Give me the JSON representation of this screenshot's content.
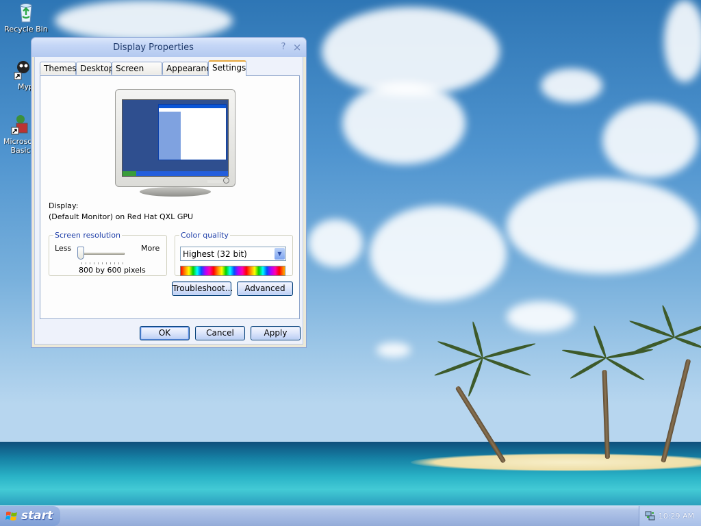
{
  "desktop": {
    "icons": [
      {
        "label": "Recycle Bin"
      },
      {
        "label": "Myp"
      },
      {
        "label": "Microsoft",
        "label2": "Basic"
      }
    ]
  },
  "dialog": {
    "title": "Display Properties",
    "help_glyph": "?",
    "close_glyph": "×",
    "tabs": [
      {
        "label": "Themes"
      },
      {
        "label": "Desktop"
      },
      {
        "label": "Screen Saver"
      },
      {
        "label": "Appearance"
      },
      {
        "label": "Settings",
        "active": true
      }
    ],
    "display_label": "Display:",
    "display_value": "(Default Monitor) on Red Hat QXL GPU",
    "resolution": {
      "group_label": "Screen resolution",
      "less_label": "Less",
      "more_label": "More",
      "value_text": "800 by 600 pixels",
      "slider_fraction": 0.0
    },
    "color_quality": {
      "group_label": "Color quality",
      "selected": "Highest (32 bit)"
    },
    "buttons": {
      "troubleshoot": "Troubleshoot...",
      "advanced": "Advanced",
      "ok": "OK",
      "cancel": "Cancel",
      "apply": "Apply"
    }
  },
  "taskbar": {
    "start_label": "start",
    "clock": "10:29 AM"
  },
  "colors": {
    "titlebar_text": "#1f3a6b",
    "group_label": "#1e3ea8",
    "active_tab_accent": "#e7a63b",
    "button_border": "#003c74"
  }
}
